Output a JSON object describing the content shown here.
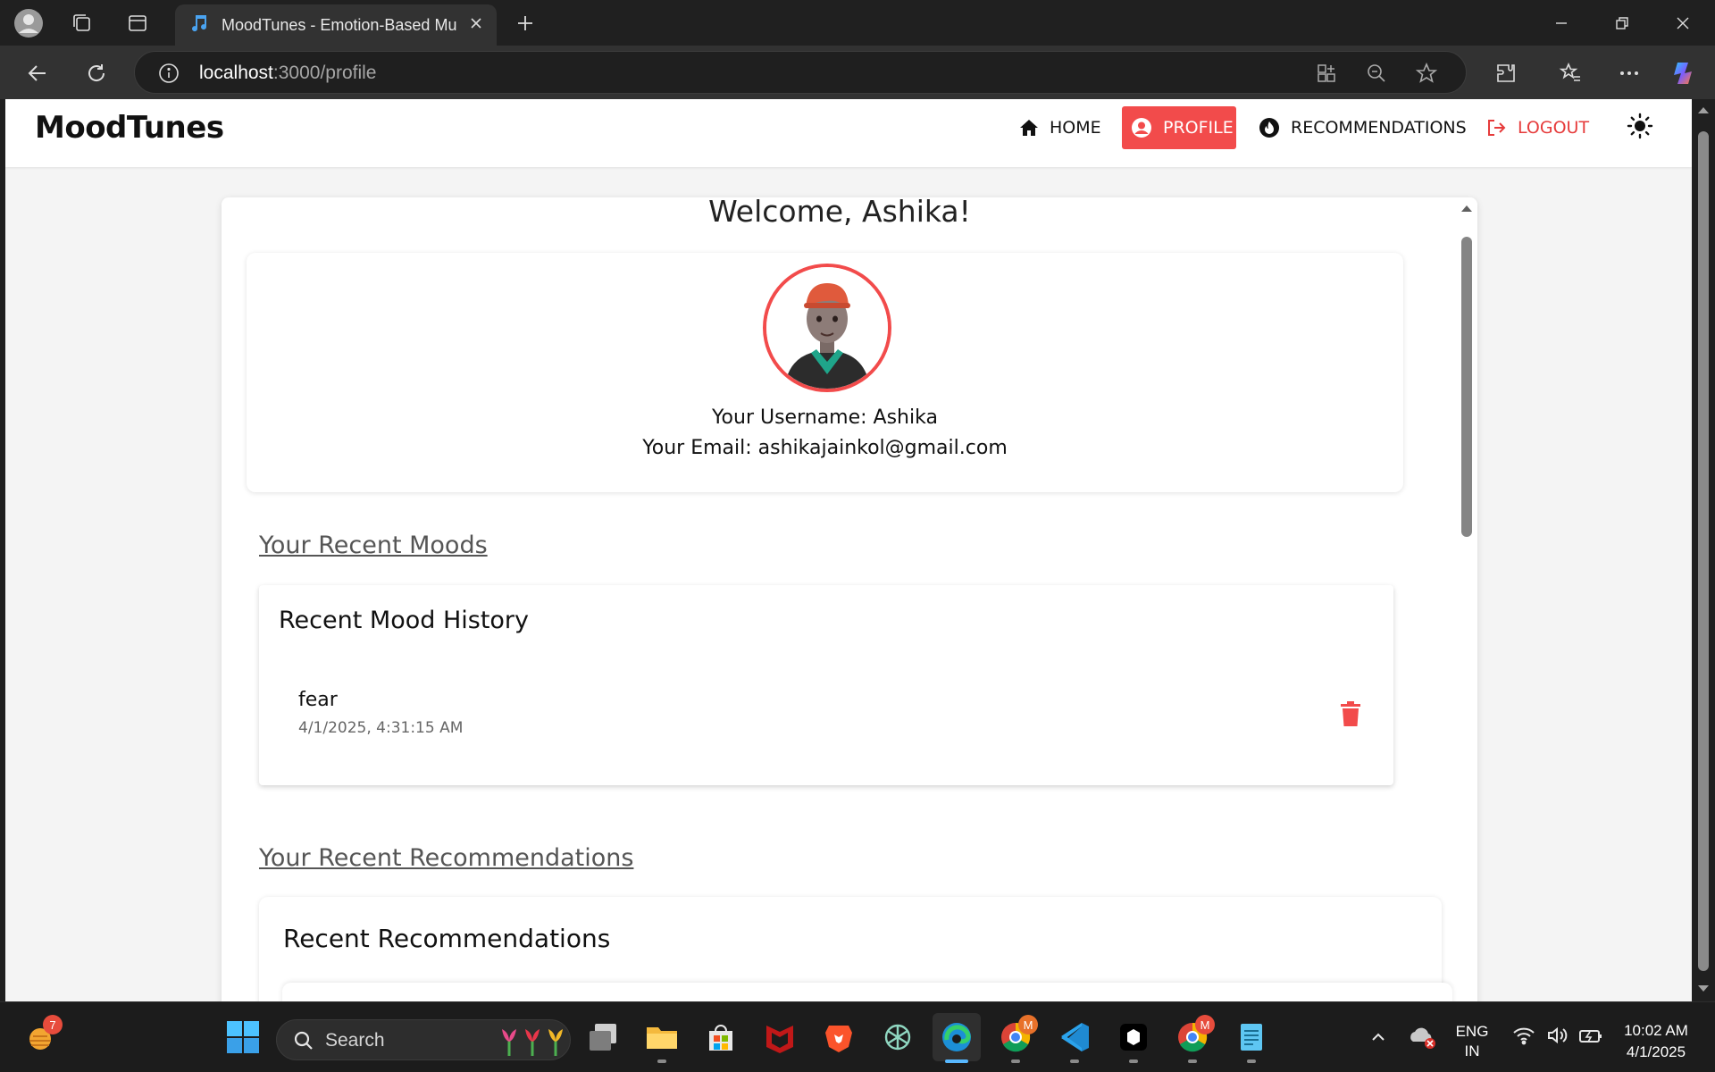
{
  "browser": {
    "tab_title": "MoodTunes - Emotion-Based Mu",
    "url_host": "localhost",
    "url_path": ":3000/profile"
  },
  "header": {
    "brand": "MoodTunes",
    "nav": {
      "home": "HOME",
      "profile": "PROFILE",
      "recommendations": "RECOMMENDATIONS",
      "logout": "LOGOUT"
    }
  },
  "profile": {
    "welcome": "Welcome, Ashika!",
    "username_line": "Your Username: Ashika",
    "email_line": "Your Email: ashikajainkol@gmail.com"
  },
  "moods": {
    "section_title": "Your Recent Moods",
    "card_title": "Recent Mood History",
    "items": [
      {
        "mood": "fear",
        "time": "4/1/2025, 4:31:15 AM"
      }
    ]
  },
  "recommendations": {
    "section_title": "Your Recent Recommendations",
    "card_title": "Recent Recommendations"
  },
  "taskbar": {
    "search_placeholder": "Search",
    "weather_badge": "7",
    "lang_line1": "ENG",
    "lang_line2": "IN",
    "time": "10:02 AM",
    "date": "4/1/2025",
    "chrome_badge": "M"
  },
  "colors": {
    "accent": "#f24b4b",
    "header_bg": "#ffffff",
    "page_bg": "#f4f4f4",
    "edge_active": "#58b8ff"
  }
}
